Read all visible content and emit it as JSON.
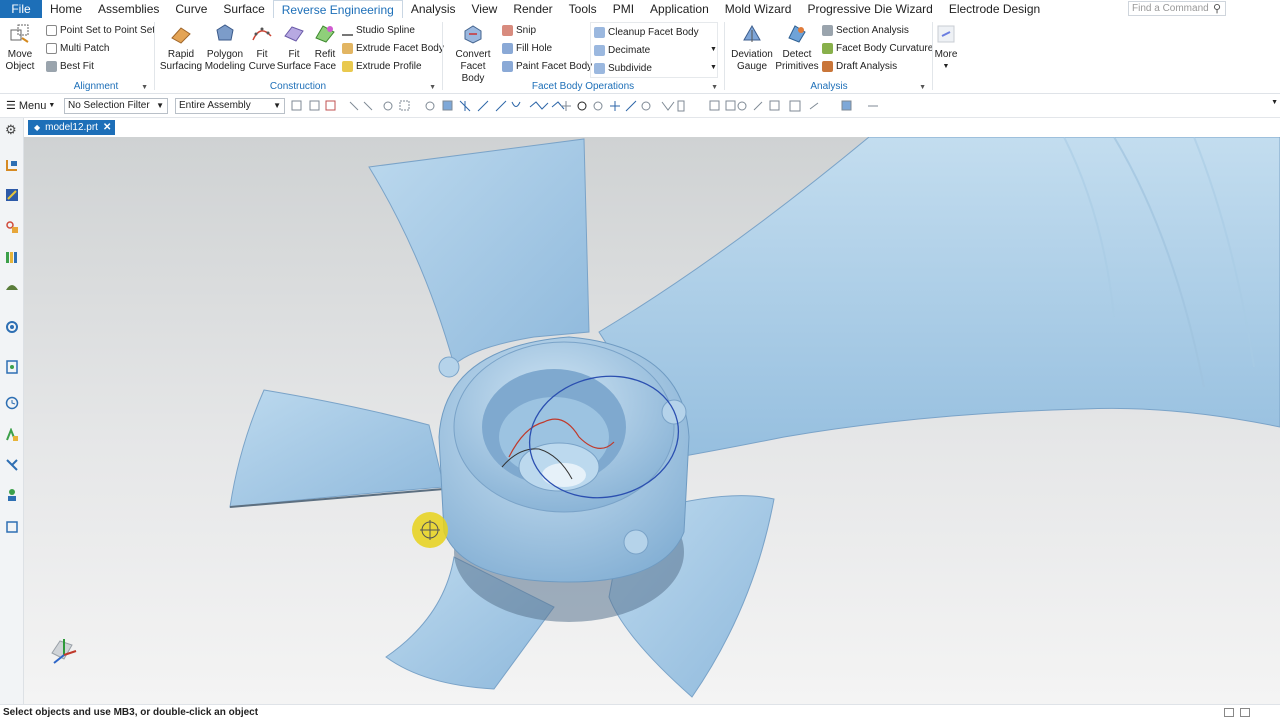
{
  "menu_tabs": [
    {
      "label": "File"
    },
    {
      "label": "Home"
    },
    {
      "label": "Assemblies"
    },
    {
      "label": "Curve"
    },
    {
      "label": "Surface"
    },
    {
      "label": "Reverse Engineering"
    },
    {
      "label": "Analysis"
    },
    {
      "label": "View"
    },
    {
      "label": "Render"
    },
    {
      "label": "Tools"
    },
    {
      "label": "PMI"
    },
    {
      "label": "Application"
    },
    {
      "label": "Mold Wizard"
    },
    {
      "label": "Progressive Die Wizard"
    },
    {
      "label": "Electrode Design"
    }
  ],
  "find_command": {
    "placeholder": "Find a Command"
  },
  "ribbon": {
    "move_object": {
      "line1": "Move",
      "line2": "Object"
    },
    "alignment": {
      "label": "Alignment",
      "items": [
        {
          "label": "Point Set to Point Set"
        },
        {
          "label": "Multi Patch"
        },
        {
          "label": "Best Fit"
        }
      ]
    },
    "construction": {
      "label": "Construction",
      "big": [
        {
          "line1": "Rapid",
          "line2": "Surfacing"
        },
        {
          "line1": "Polygon",
          "line2": "Modeling"
        },
        {
          "line1": "Fit",
          "line2": "Curve"
        },
        {
          "line1": "Fit",
          "line2": "Surface"
        },
        {
          "line1": "Refit",
          "line2": "Face"
        }
      ],
      "items": [
        {
          "label": "Studio Spline"
        },
        {
          "label": "Extrude Facet Body"
        },
        {
          "label": "Extrude Profile"
        }
      ]
    },
    "facet_ops": {
      "label": "Facet Body Operations",
      "big": {
        "line1": "Convert",
        "line2": "Facet Body"
      },
      "col1": [
        {
          "label": "Snip"
        },
        {
          "label": "Fill Hole"
        },
        {
          "label": "Paint Facet Body"
        }
      ],
      "col2": [
        {
          "label": "Cleanup Facet Body"
        },
        {
          "label": "Decimate"
        },
        {
          "label": "Subdivide"
        }
      ]
    },
    "analysis": {
      "label": "Analysis",
      "big": [
        {
          "line1": "Deviation",
          "line2": "Gauge"
        },
        {
          "line1": "Detect",
          "line2": "Primitives"
        }
      ],
      "items": [
        {
          "label": "Section Analysis"
        },
        {
          "label": "Facet Body Curvature"
        },
        {
          "label": "Draft Analysis"
        }
      ]
    },
    "more": {
      "label": "More"
    }
  },
  "selection_bar": {
    "menu_label": "Menu",
    "selection_filter": "No Selection Filter",
    "scope": "Entire Assembly"
  },
  "document": {
    "tab_name": "model12.prt"
  },
  "status": {
    "message": "Select objects and use MB3, or double-click an object"
  },
  "colors": {
    "accent": "#1d6fb8",
    "model": "#a9cbe4",
    "background_top": "#cfd2d3",
    "cursor_highlight": "#e8d21a"
  }
}
